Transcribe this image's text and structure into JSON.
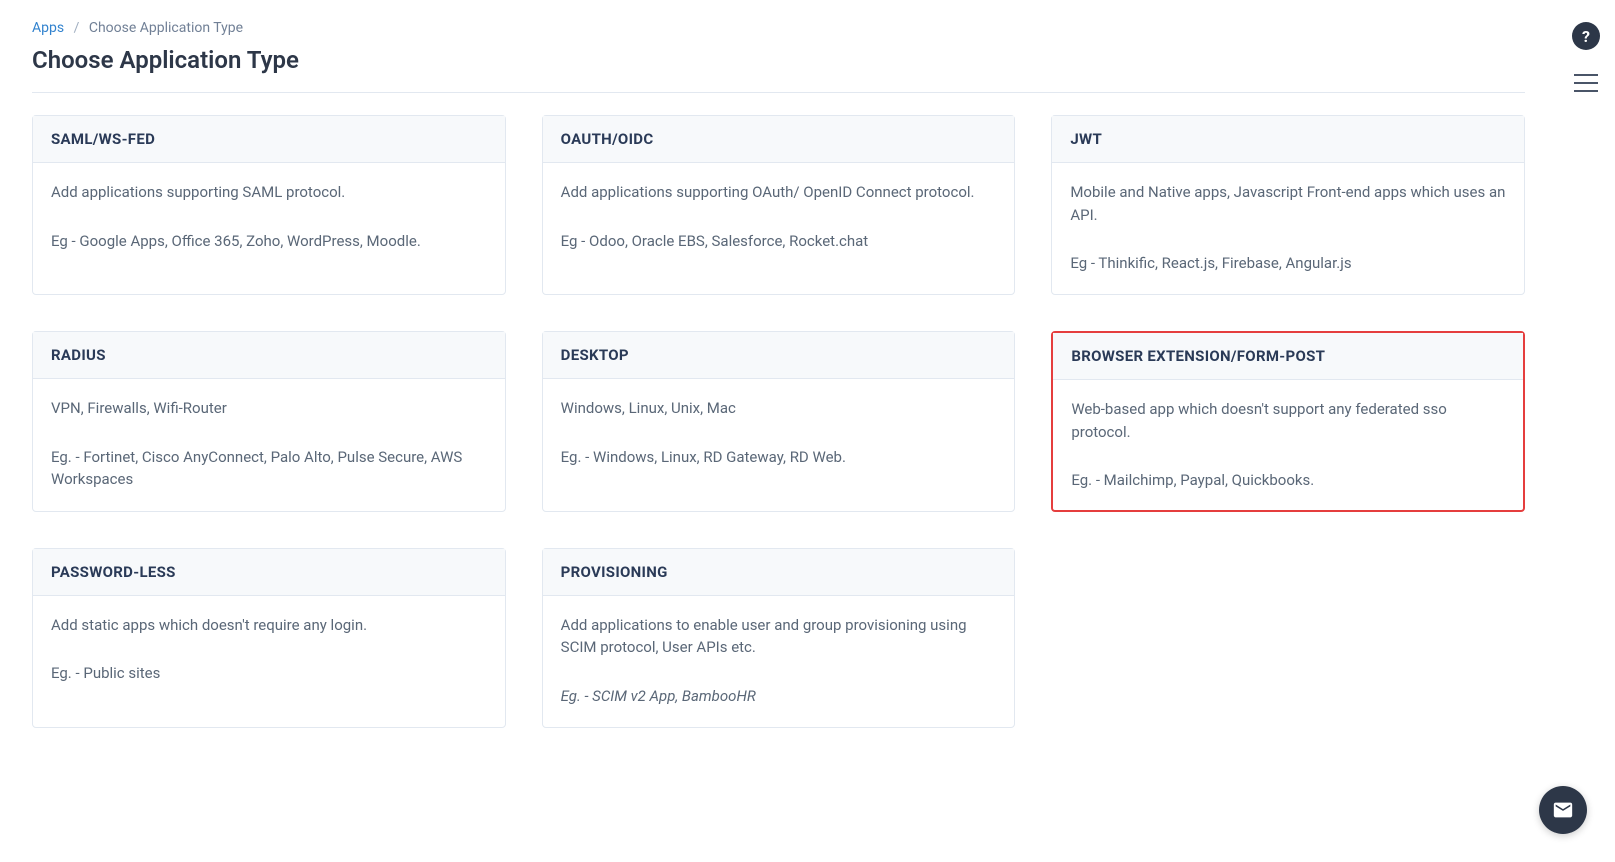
{
  "breadcrumb": {
    "root": "Apps",
    "current": "Choose Application Type"
  },
  "page_title": "Choose Application Type",
  "cards": [
    {
      "title": "SAML/WS-FED",
      "desc": "Add applications supporting SAML protocol.",
      "example": "Eg - Google Apps, Office 365, Zoho, WordPress, Moodle.",
      "highlighted": false,
      "italic_example": false
    },
    {
      "title": "OAUTH/OIDC",
      "desc": "Add applications supporting OAuth/ OpenID Connect protocol.",
      "example": "Eg - Odoo, Oracle EBS, Salesforce, Rocket.chat",
      "highlighted": false,
      "italic_example": false
    },
    {
      "title": "JWT",
      "desc": "Mobile and Native apps, Javascript Front-end apps which uses an API.",
      "example": "Eg - Thinkific, React.js, Firebase, Angular.js",
      "highlighted": false,
      "italic_example": false
    },
    {
      "title": "RADIUS",
      "desc": "VPN, Firewalls, Wifi-Router",
      "example": "Eg. - Fortinet, Cisco AnyConnect, Palo Alto, Pulse Secure, AWS Workspaces",
      "highlighted": false,
      "italic_example": false
    },
    {
      "title": "DESKTOP",
      "desc": "Windows, Linux, Unix, Mac",
      "example": "Eg. - Windows, Linux, RD Gateway, RD Web.",
      "highlighted": false,
      "italic_example": false
    },
    {
      "title": "BROWSER EXTENSION/FORM-POST",
      "desc": "Web-based app which doesn't support any federated sso protocol.",
      "example": "Eg. - Mailchimp, Paypal, Quickbooks.",
      "highlighted": true,
      "italic_example": false
    },
    {
      "title": "PASSWORD-LESS",
      "desc": "Add static apps which doesn't require any login.",
      "example": "Eg. - Public sites",
      "highlighted": false,
      "italic_example": false
    },
    {
      "title": "PROVISIONING",
      "desc": "Add applications to enable user and group provisioning using SCIM protocol, User APIs etc.",
      "example": "Eg. - SCIM v2 App, BambooHR",
      "highlighted": false,
      "italic_example": true
    }
  ],
  "icons": {
    "help": "?",
    "chat": "mail-icon"
  }
}
